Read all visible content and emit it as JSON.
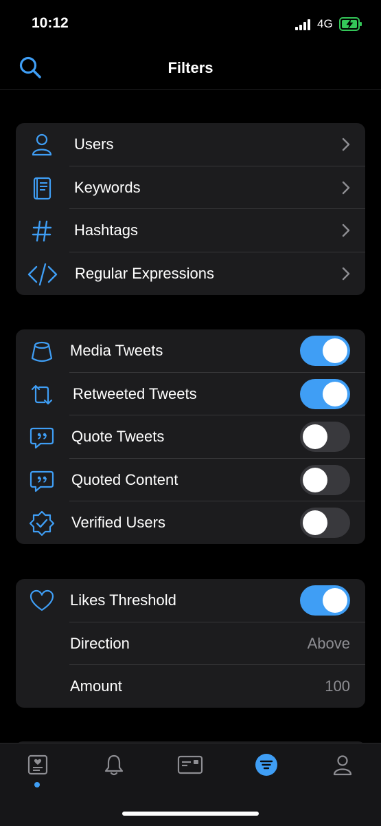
{
  "status_bar": {
    "time": "10:12",
    "network": "4G"
  },
  "nav": {
    "title": "Filters"
  },
  "filter_types": [
    {
      "label": "Users",
      "icon": "person-icon"
    },
    {
      "label": "Keywords",
      "icon": "book-icon"
    },
    {
      "label": "Hashtags",
      "icon": "hashtag-icon"
    },
    {
      "label": "Regular Expressions",
      "icon": "code-icon"
    }
  ],
  "toggles": [
    {
      "label": "Media Tweets",
      "on": true,
      "icon": "media-icon"
    },
    {
      "label": "Retweeted Tweets",
      "on": true,
      "icon": "retweet-icon"
    },
    {
      "label": "Quote Tweets",
      "on": false,
      "icon": "quote-icon"
    },
    {
      "label": "Quoted Content",
      "on": false,
      "icon": "quote-icon"
    },
    {
      "label": "Verified Users",
      "on": false,
      "icon": "verified-badge-icon"
    }
  ],
  "likes": {
    "label": "Likes Threshold",
    "on": true,
    "direction_label": "Direction",
    "direction_value": "Above",
    "amount_label": "Amount",
    "amount_value": "100"
  },
  "tabs": [
    "timeline-icon",
    "bell-icon",
    "card-icon",
    "filter-icon",
    "profile-icon"
  ],
  "colors": {
    "accent": "#3f9ef5",
    "card": "#1c1c1e",
    "background": "#000000",
    "secondary_text": "#8e8e93"
  }
}
